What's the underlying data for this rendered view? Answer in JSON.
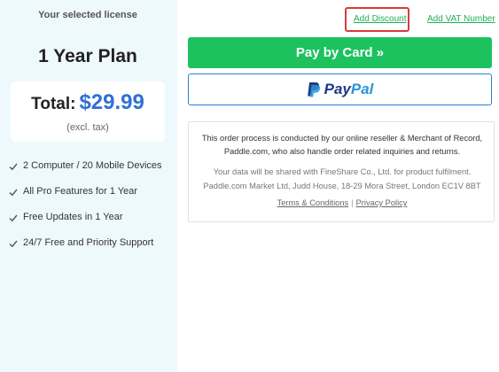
{
  "license": {
    "heading": "Your selected license",
    "plan_name": "1 Year Plan",
    "total_label": "Total:",
    "total_amount": "$29.99",
    "tax_note": "(excl. tax)",
    "features": [
      "2 Computer / 20 Mobile Devices",
      "All Pro Features for 1 Year",
      "Free Updates in 1 Year",
      "24/7 Free and Priority Support"
    ]
  },
  "links": {
    "add_discount": "Add Discount",
    "add_vat": "Add VAT Number"
  },
  "payment": {
    "card_button": "Pay by Card »",
    "paypal_pay": "Pay",
    "paypal_pal": "Pal"
  },
  "info": {
    "line1": "This order process is conducted by our online reseller & Merchant of Record,",
    "line2": "Paddle.com, who also handle order related inquiries and returns.",
    "line3": "Your data will be shared with FineShare Co., Ltd. for product fulfilment.",
    "line4": "Paddle.com Market Ltd, Judd House, 18-29 Mora Street, London EC1V 8BT",
    "terms": "Terms & Conditions",
    "separator": "|",
    "privacy": "Privacy Policy"
  },
  "colors": {
    "accent_green": "#1dc25f",
    "price_blue": "#2f6fd6",
    "highlight_red": "#d93b3b",
    "left_panel_bg": "#eef9fd"
  }
}
